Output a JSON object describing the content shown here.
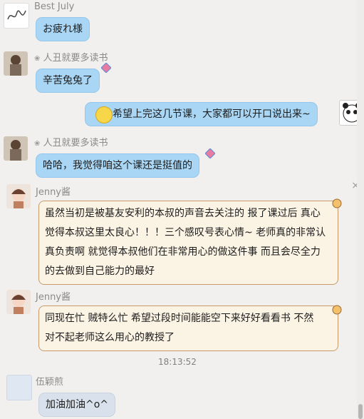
{
  "messages": [
    {
      "sender": "Best July",
      "text": "お疲れ様"
    },
    {
      "sender": "人丑就要多读书",
      "text": "辛苦兔兔了"
    },
    {
      "sender": "",
      "text": "希望上完这几节课，大家都可以开口说出来~"
    },
    {
      "sender": "人丑就要多读书",
      "text": "哈哈，我觉得咱这个课还是挺值的"
    },
    {
      "sender": "Jenny酱",
      "lines": [
        "虽然当初是被基友安利的本叔的声音去关注的 报了课过后 真心",
        "觉得本叔这里太良心！！！三个感叹号表心情~ 老师真的非常认",
        "真负责啊  就觉得本叔他们在非常用心的做这件事 而且会尽全力",
        "的去做到自己能力的最好"
      ]
    },
    {
      "sender": "Jenny酱",
      "lines": [
        "同现在忙  贼特么忙  希望过段时间能能空下来好好看看书  不然",
        "对不起老师这么用心的教授了"
      ]
    },
    {
      "timestamp": "18:13:52"
    },
    {
      "sender": "伍颖煎",
      "text": "加油加油^o^"
    }
  ],
  "icons": {
    "close": "×"
  }
}
